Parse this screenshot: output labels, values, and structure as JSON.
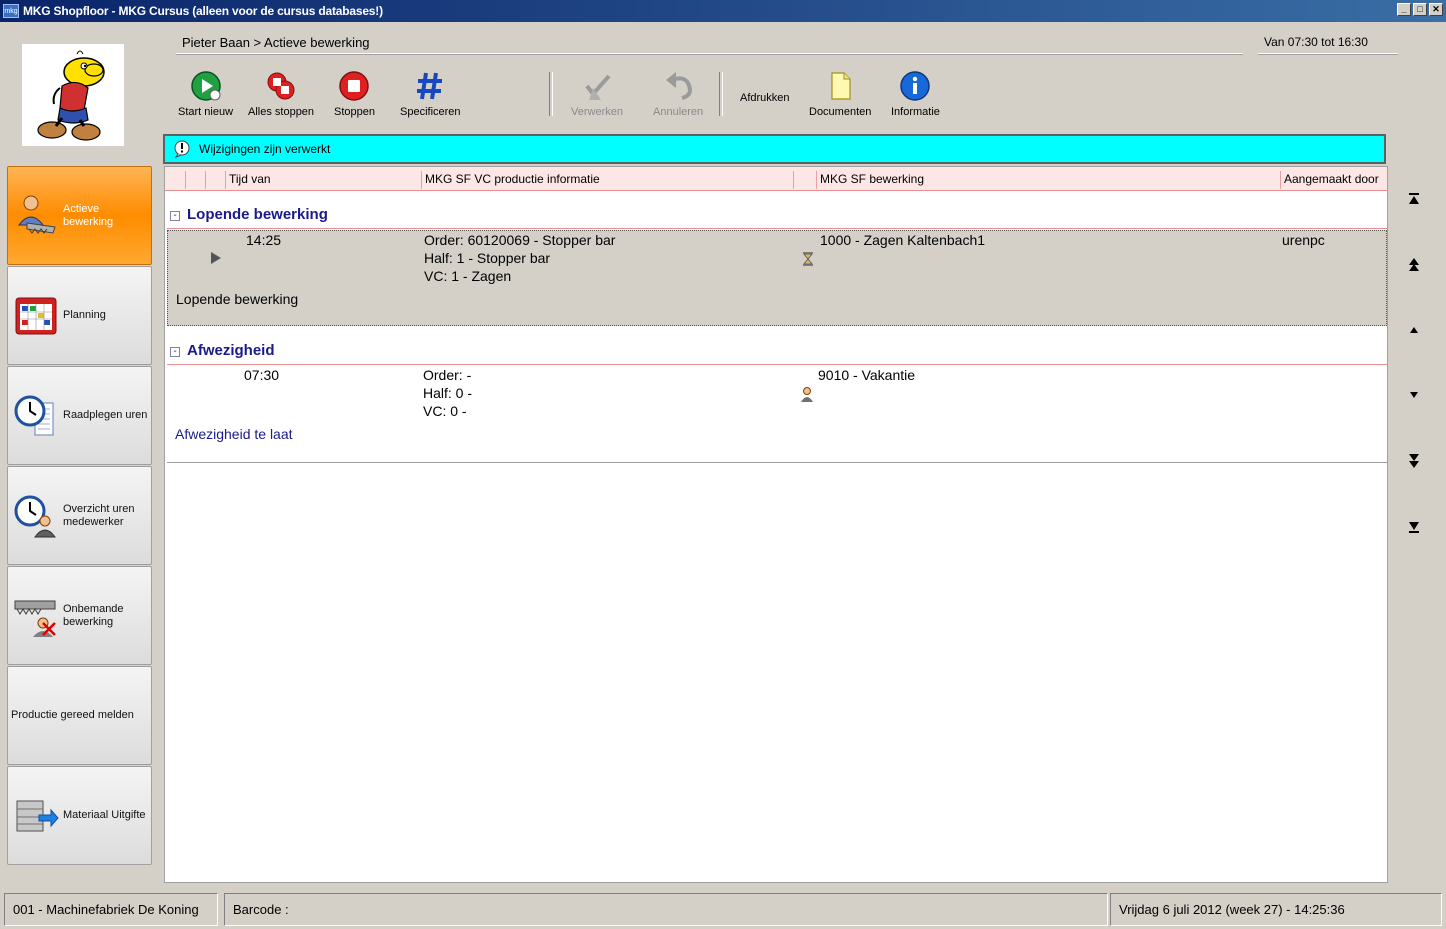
{
  "window": {
    "title": "MKG Shopfloor - MKG Cursus (alleen voor de cursus databases!)",
    "icon_text": "mkg"
  },
  "header": {
    "breadcrumb": "Pieter Baan > Actieve bewerking",
    "shift": "Van 07:30 tot 16:30"
  },
  "nav": {
    "items": [
      {
        "label": "Actieve\nbewerking",
        "icon": "worker-saw-icon",
        "active": true
      },
      {
        "label": "Planning",
        "icon": "calendar-icon",
        "active": false
      },
      {
        "label": "Raadplegen uren",
        "icon": "clock-list-icon",
        "active": false
      },
      {
        "label": "Overzicht uren\nmedewerker",
        "icon": "clock-worker-icon",
        "active": false
      },
      {
        "label": "Onbemande\nbewerking",
        "icon": "unmanned-icon",
        "active": false
      },
      {
        "label": "Productie gereed melden",
        "icon": "",
        "active": false
      },
      {
        "label": "Materiaal Uitgifte",
        "icon": "material-issue-icon",
        "active": false
      }
    ]
  },
  "toolbar": {
    "start_new": "Start nieuw",
    "stop_all": "Alles stoppen",
    "stop": "Stoppen",
    "specify": "Specificeren",
    "process": "Verwerken",
    "cancel": "Annuleren",
    "print": "Afdrukken",
    "documents": "Documenten",
    "info": "Informatie"
  },
  "infobar": {
    "message": "Wijzigingen zijn verwerkt"
  },
  "grid": {
    "columns": [
      "Tijd van",
      "MKG SF VC productie informatie",
      "MKG SF bewerking",
      "Aangemaakt door"
    ],
    "groups": [
      {
        "title": "Lopende bewerking",
        "toggle": "-",
        "row": {
          "time": "14:25",
          "info": [
            "Order: 60120069 - Stopper bar",
            "Half: 1 - Stopper bar",
            "VC: 1 - Zagen"
          ],
          "operation": "1000 - Zagen Kaltenbach1",
          "created_by": "urenpc",
          "footer": "Lopende bewerking"
        }
      },
      {
        "title": "Afwezigheid",
        "toggle": "-",
        "row": {
          "time": "07:30",
          "info": [
            "Order:  -",
            "Half: 0 -",
            "VC: 0 -"
          ],
          "operation": "9010 - Vakantie",
          "created_by": "",
          "footer": "Afwezigheid te laat"
        }
      }
    ]
  },
  "status": {
    "company": "001 - Machinefabriek De Koning",
    "barcode_label": "Barcode :",
    "datetime": "Vrijdag 6 juli 2012 (week 27)  - 14:25:36"
  },
  "colors": {
    "infobar": "#00ffff",
    "active_nav": "#ff8c00",
    "group_title": "#1a1a8c",
    "link": "#1a1a8c"
  }
}
